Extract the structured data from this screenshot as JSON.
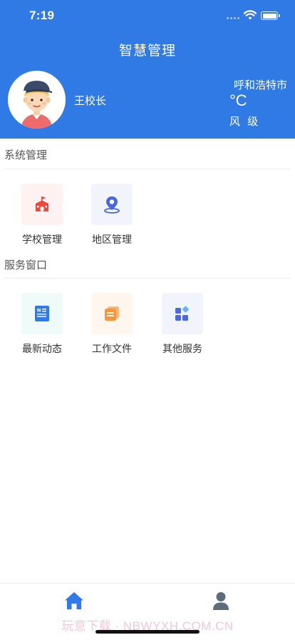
{
  "status_bar": {
    "time": "7:19"
  },
  "header": {
    "title": "智慧管理",
    "user_name": "王校长",
    "city": "呼和浩特市",
    "temperature": "°C",
    "wind": "风 级"
  },
  "sections": [
    {
      "title": "系统管理",
      "items": [
        {
          "label": "学校管理",
          "icon": "school-icon",
          "bg": "#fff2f0",
          "color": "#f0473c"
        },
        {
          "label": "地区管理",
          "icon": "location-pin-icon",
          "bg": "#f2f4fb",
          "color": "#4866e0"
        }
      ]
    },
    {
      "title": "服务窗口",
      "items": [
        {
          "label": "最新动态",
          "icon": "news-icon",
          "bg": "#eefbf8",
          "color": "#2e7ae6"
        },
        {
          "label": "工作文件",
          "icon": "documents-icon",
          "bg": "#fff6ee",
          "color": "#f5963b"
        },
        {
          "label": "其他服务",
          "icon": "apps-icon",
          "bg": "#f2f4fb",
          "color": "#4a6ae0"
        }
      ]
    }
  ],
  "tabbar": {
    "items": [
      {
        "icon": "home-icon",
        "active_color": "#2f7ae5"
      },
      {
        "icon": "user-icon",
        "color": "#5e6b78"
      }
    ]
  },
  "watermark": "玩意下载 · NBWYXH.COM.CN",
  "colors": {
    "primary": "#2f7ae5"
  }
}
